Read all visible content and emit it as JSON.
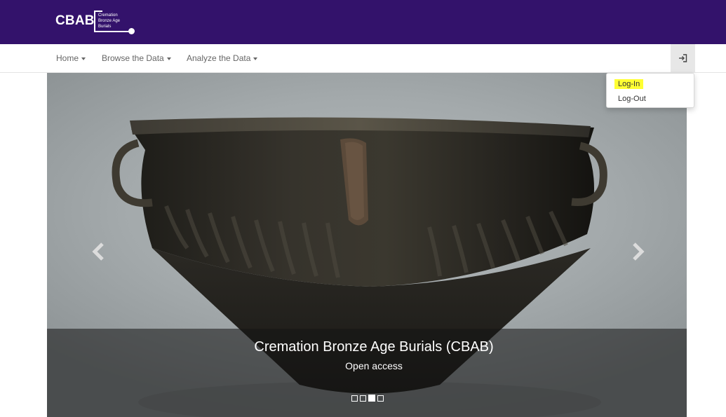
{
  "header": {
    "logo_abbr": "CBAB",
    "logo_full": "Cremation\nBronze Age\nBurials"
  },
  "nav": {
    "items": [
      {
        "label": "Home"
      },
      {
        "label": "Browse the Data"
      },
      {
        "label": "Analyze the Data"
      }
    ],
    "login_icon": "sign-in-icon"
  },
  "dropdown": {
    "items": [
      {
        "label": "Log-In",
        "highlighted": true
      },
      {
        "label": "Log-Out"
      }
    ]
  },
  "carousel": {
    "title": "Cremation Bronze Age Burials (CBAB)",
    "subtitle": "Open access",
    "slide_count": 4,
    "active_index": 2,
    "prev_icon": "chevron-left-icon",
    "next_icon": "chevron-right-icon"
  },
  "colors": {
    "header_bg": "#33126b",
    "highlight": "#ffff33"
  }
}
